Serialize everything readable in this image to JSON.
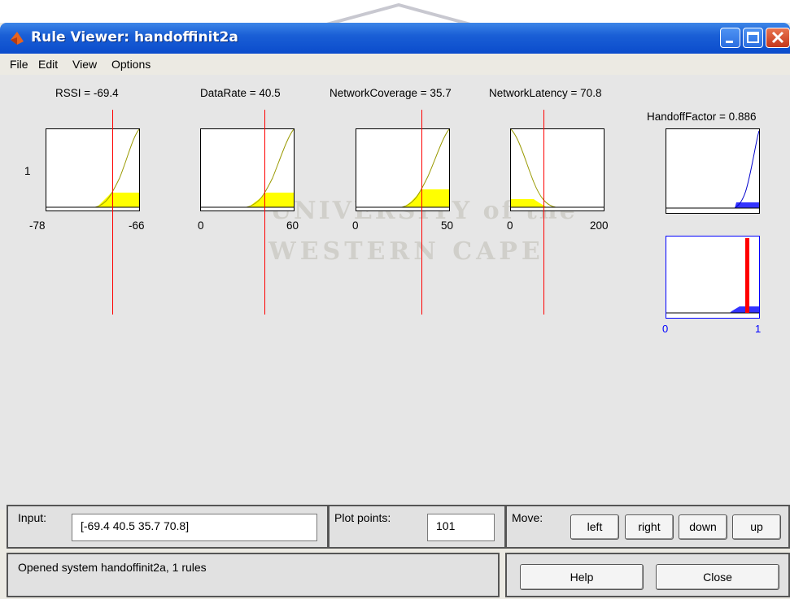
{
  "window": {
    "title": "Rule Viewer: handoffinit2a"
  },
  "menu": [
    "File",
    "Edit",
    "View",
    "Options"
  ],
  "inputs": [
    {
      "label": "RSSI = -69.4",
      "min_label": "-78",
      "max_label": "-66"
    },
    {
      "label": "DataRate = 40.5",
      "min_label": "0",
      "max_label": "60"
    },
    {
      "label": "NetworkCoverage = 35.7",
      "min_label": "0",
      "max_label": "50"
    },
    {
      "label": "NetworkLatency = 70.8",
      "min_label": "0",
      "max_label": "200"
    }
  ],
  "rule_number": "1",
  "output": {
    "label": "HandoffFactor = 0.886",
    "min_label": "0",
    "max_label": "1"
  },
  "watermark": {
    "line1": "UNIVERSITY of the",
    "line2": "WESTERN CAPE"
  },
  "controls": {
    "input_label": "Input:",
    "input_value": "[-69.4 40.5 35.7 70.8]",
    "plot_points_label": "Plot points:",
    "plot_points_value": "101",
    "move_label": "Move:",
    "move_buttons": [
      "left",
      "right",
      "down",
      "up"
    ],
    "status": "Opened system handoffinit2a, 1 rules",
    "help_label": "Help",
    "close_label": "Close"
  },
  "colors": {
    "membership_fill": "#ffff00",
    "output_fill": "#3333ff",
    "crosshair": "#ff0000"
  }
}
